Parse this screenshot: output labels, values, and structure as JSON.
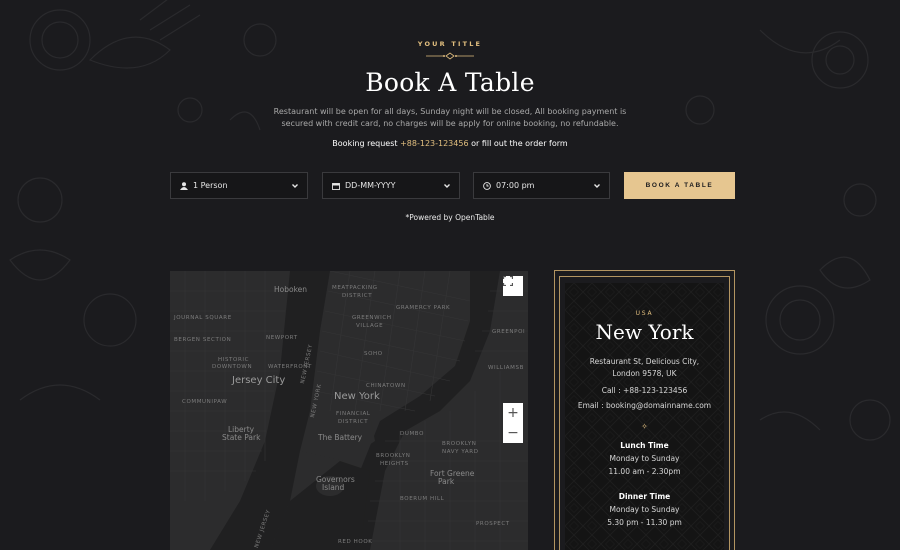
{
  "header": {
    "eyebrow": "YOUR TITLE",
    "title": "Book A Table",
    "description": "Restaurant will be open for all days, Sunday night will be closed, All booking payment is secured with credit card, no charges will be apply for online booking, no refundable.",
    "booking_prefix": "Booking request",
    "booking_phone": "+88-123-123456",
    "booking_suffix": "or fill out the order form"
  },
  "form": {
    "persons": {
      "value": "1 Person",
      "icon": "user-icon"
    },
    "date": {
      "value": "DD-MM-YYYY",
      "icon": "calendar-icon"
    },
    "time": {
      "value": "07:00 pm",
      "icon": "clock-icon"
    },
    "submit_label": "BOOK A TABLE"
  },
  "powered_by": "*Powered by OpenTable",
  "map": {
    "labels": {
      "hoboken": "Hoboken",
      "meatpacking": "MEATPACKING",
      "district": "DISTRICT",
      "gramercy": "GRAMERCY PARK",
      "journal_square": "JOURNAL SQUARE",
      "greenwich": "GREENWICH",
      "village": "VILLAGE",
      "greenpoint": "GREENPOI",
      "bergen": "BERGEN SECTION",
      "newport": "NEWPORT",
      "soho": "SOHO",
      "historic": "HISTORIC",
      "downtown": "DOWNTOWN",
      "waterfront": "WATERFRONT",
      "jersey_city": "Jersey City",
      "chinatown": "CHINATOWN",
      "williamsburg": "WILLIAMSB",
      "new_york": "New York",
      "communipaw": "COMMUNIPAW",
      "nj": "NEW JERSEY",
      "ny": "NEW YORK",
      "financial": "FINANCIAL",
      "district2": "DISTRICT",
      "liberty": "Liberty",
      "state_park": "State Park",
      "battery": "The Battery",
      "dumbo": "DUMBO",
      "brooklyn_navy": "BROOKLYN",
      "navy_yard": "NAVY YARD",
      "brooklyn_heights": "BROOKLYN",
      "heights": "HEIGHTS",
      "fort_greene": "Fort Greene",
      "park": "Park",
      "governors": "Governors",
      "island": "Island",
      "boerum": "BOERUM HILL",
      "red_hook": "RED HOOK",
      "prospect": "PROSPECT",
      "state2": "NEW JERSEY"
    },
    "fullscreen_icon": "fullscreen-icon",
    "zoom_in": "+",
    "zoom_out": "−"
  },
  "location_card": {
    "country": "USA",
    "city": "New York",
    "address_line1": "Restaurant St, Delicious City,",
    "address_line2": "London 9578, UK",
    "call": "Call : +88-123-123456",
    "email": "Email : booking@domainname.com",
    "lunch_title": "Lunch Time",
    "lunch_days": "Monday to Sunday",
    "lunch_hours": "11.00 am - 2.30pm",
    "dinner_title": "Dinner Time",
    "dinner_days": "Monday to Sunday",
    "dinner_hours": "5.30 pm - 11.30 pm"
  },
  "colors": {
    "background": "#1b1b1e",
    "accent": "#e2bf7f",
    "button": "#e6c690"
  }
}
